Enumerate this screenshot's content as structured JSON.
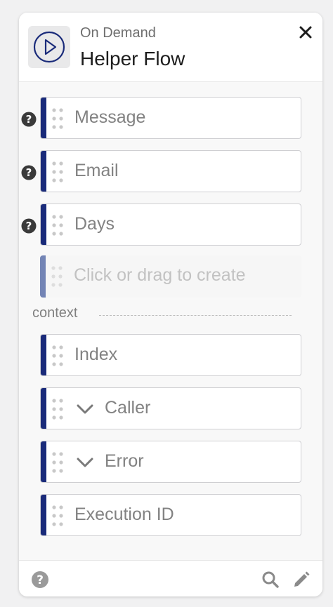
{
  "header": {
    "subtitle": "On Demand",
    "title": "Helper Flow",
    "icon": "play-circle-icon",
    "close_icon": "close-icon"
  },
  "inputs": [
    {
      "label": "Message",
      "help_icon": "question-icon"
    },
    {
      "label": "Email",
      "help_icon": "question-icon"
    },
    {
      "label": "Days",
      "help_icon": "question-icon"
    }
  ],
  "create_placeholder": "Click or drag to create",
  "context": {
    "label": "context",
    "fields": [
      {
        "label": "Index",
        "expandable": false
      },
      {
        "label": "Caller",
        "expandable": true
      },
      {
        "label": "Error",
        "expandable": true
      },
      {
        "label": "Execution ID",
        "expandable": false
      }
    ]
  },
  "footer": {
    "help_icon": "question-icon",
    "search_icon": "search-icon",
    "edit_icon": "pencil-icon"
  },
  "colors": {
    "accent_bar": "#1a2b7a",
    "placeholder_bar": "#7384b5",
    "icon_circle": "#1a2b7a"
  }
}
